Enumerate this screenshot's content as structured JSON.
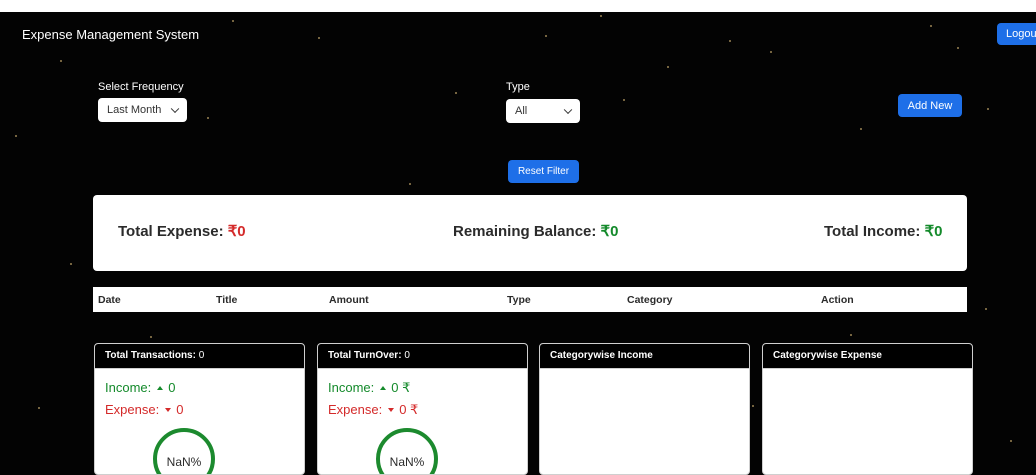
{
  "header": {
    "app_title": "Expense Management System",
    "logout_label": "Logou"
  },
  "filters": {
    "frequency_label": "Select Frequency",
    "frequency_value": "Last Month",
    "type_label": "Type",
    "type_value": "All",
    "add_new_label": "Add New",
    "reset_label": "Reset Filter"
  },
  "totals": {
    "expense_label": "Total Expense:",
    "expense_value": "₹0",
    "balance_label": "Remaining Balance:",
    "balance_value": "₹0",
    "income_label": "Total Income:",
    "income_value": "₹0"
  },
  "table": {
    "columns": [
      "Date",
      "Title",
      "Amount",
      "Type",
      "Category",
      "Action"
    ]
  },
  "cards": {
    "transactions": {
      "title": "Total Transactions:",
      "count": "0",
      "income_label": "Income:",
      "income_value": "0",
      "expense_label": "Expense:",
      "expense_value": "0",
      "percent": "NaN%"
    },
    "turnover": {
      "title": "Total TurnOver:",
      "amount": "0",
      "income_label": "Income:",
      "income_value": "0 ₹",
      "expense_label": "Expense:",
      "expense_value": "0 ₹",
      "percent": "NaN%"
    },
    "category_income": {
      "title": "Categorywise Income"
    },
    "category_expense": {
      "title": "Categorywise Expense"
    }
  },
  "colors": {
    "background": "#030303",
    "accent": "#1e6fe8",
    "income": "#148a2b",
    "expense": "#d42a2a"
  }
}
